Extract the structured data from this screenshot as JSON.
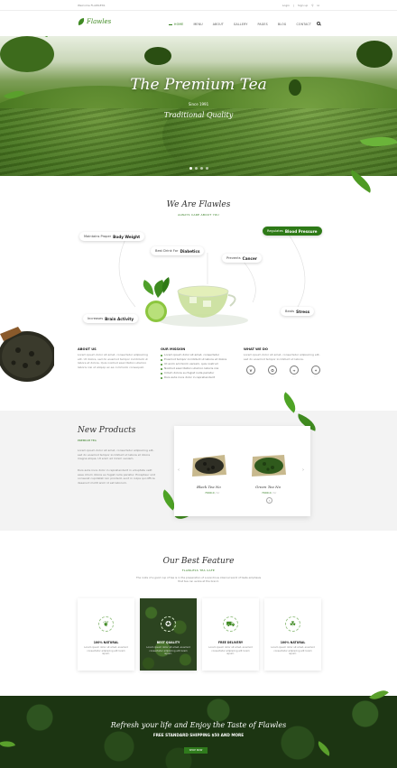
{
  "topbar": {
    "welcome": "Welcome FLAWLESS",
    "login": "Login",
    "signup": "Sign up"
  },
  "brand": {
    "name": "Flawles"
  },
  "nav": [
    {
      "label": "HOME"
    },
    {
      "label": "MENU"
    },
    {
      "label": "ABOUT"
    },
    {
      "label": "GALLERY"
    },
    {
      "label": "PAGES"
    },
    {
      "label": "BLOG"
    },
    {
      "label": "CONTACT"
    }
  ],
  "hero": {
    "title": "The Premium Tea",
    "since": "Since 1991",
    "subtitle": "Traditional Quality"
  },
  "about": {
    "title": "We Are Flawles",
    "subtitle": "ALWAYS CARE ABOUT YOU",
    "benefits": [
      {
        "pre": "Maintains Proper",
        "bold": "Body Weight"
      },
      {
        "pre": "Best Drink For",
        "bold": "Diabetics"
      },
      {
        "pre": "Regulates",
        "bold": "Blood Pressure"
      },
      {
        "pre": "Prevents",
        "bold": "Cancer"
      },
      {
        "pre": "Increases",
        "bold": "Brain Activity"
      },
      {
        "pre": "Beats",
        "bold": "Stress"
      }
    ],
    "cols": {
      "about_us": {
        "title": "ABOUT US",
        "text": "Lorem ipsum dolor sit amet, consectetur adipisicing elit. Ut dolore, sed do eiusmod tempor incididunt ut labore et dolore. Quis nostrud exercitation ullamco laboris nisi ut aliquip ex ea commodo consequat."
      },
      "mission": {
        "title": "OUR MISSION",
        "items": [
          "Lorem ipsum dolor sit amet, consectetur",
          "Eiusmod tempor incididunt ut labore et dolore",
          "Ut enim ad minim veniam, quis nostrud",
          "Nostrud exercitation ullamco laboris nisi",
          "Cillum dolore eu fugiat nulla pariatur",
          "Duis aute irure dolor in reprehenderit"
        ]
      },
      "what_we_do": {
        "title": "WHAT WE DO",
        "text": "Lorem ipsum dolor sit amet, consectetur adipisicing elit, sed do eiusmod tempor incididunt ut labore."
      }
    }
  },
  "products": {
    "title": "New Products",
    "subtitle": "PREMIUM TEA",
    "text1": "Lorem ipsum dolor sit amet, consectetur adipisicing elit, sed do eiusmod tempor incididunt ut labore et dolore magna aliqua. Ut enim ad minim veniam.",
    "text2": "Duis aute irure dolor in reprehenderit in voluptate velit esse cillum dolore eu fugiat nulla pariatur. Excepteur sint occaecat cupidatat non proident, sunt in culpa qui officia deserunt mollit anim id est laborum.",
    "items": [
      {
        "name": "Black Tea No",
        "price": "7000.0",
        "unit": "/ kr"
      },
      {
        "name": "Green Tea No",
        "price": "7000.0",
        "unit": "/ kr"
      }
    ]
  },
  "features": {
    "title": "Our Best Feature",
    "subtitle": "FLAWLESS TEA CAFE",
    "intro": "The roots of a good cup of tea is in the preparation of a wondrous internal world of taste emphasis that tea can evoke at the brand.",
    "cards": [
      {
        "title": "100% NATURAL",
        "text": "Lorem ipsum dolor sit amet, eiusmod consectetur adipiscing elit lorem ispum."
      },
      {
        "title": "BEST QUALITY",
        "text": "Lorem ipsum dolor sit amet, eiusmod consectetur adipiscing elit lorem ispum."
      },
      {
        "title": "FREE DELIVERY",
        "text": "Lorem ipsum dolor sit amet, eiusmod consectetur adipiscing elit lorem ispum."
      },
      {
        "title": "100% NATURAL",
        "text": "Lorem ipsum dolor sit amet, eiusmod consectetur adipiscing elit lorem ispum."
      }
    ]
  },
  "banner": {
    "title": "Refresh your life and Enjoy the Taste of Flawles",
    "offer": "FREE STANDARD SHIPPING $50 AND MORE",
    "button": "SHOP NOW"
  },
  "colors": {
    "accent": "#2f7a1c"
  }
}
